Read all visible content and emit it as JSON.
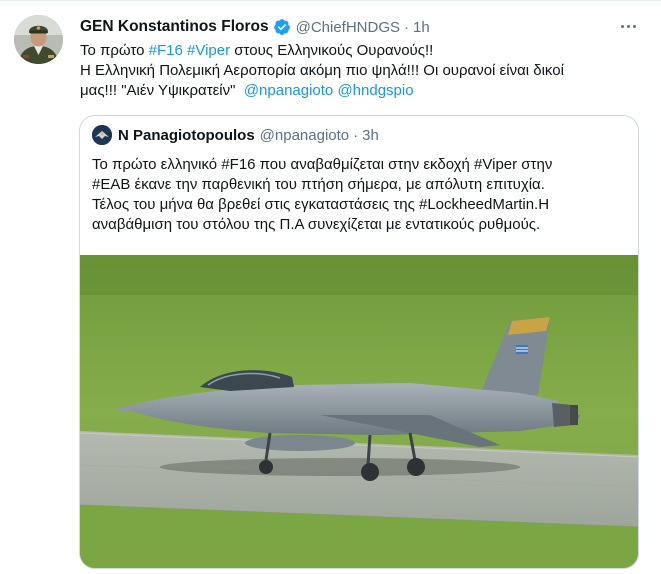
{
  "tweet": {
    "name": "GEN Konstantinos Floros",
    "handle": "@ChiefHNDGS",
    "separator": "·",
    "time": "1h",
    "line1": {
      "pre": "Το πρώτο ",
      "tag1": "#F16",
      "space": " ",
      "tag2": "#Viper",
      "post": " στους Ελληνικούς Ουρανούς!!"
    },
    "line2": "Η Ελληνική Πολεμική Αεροπορία ακόμη πιο ψηλά!!! Οι ουρανοί είναι δικοί",
    "line3": {
      "pre": "μας!!! \"Αιέν Υψικρατείν\"  ",
      "mention1": "@npanagioto",
      "space": " ",
      "mention2": "@hndgspio"
    }
  },
  "quote": {
    "name": "N Panagiotopoulos",
    "handle": "@npanagioto",
    "separator": "·",
    "time": "3h",
    "line1": "Το πρώτο ελληνικό #F16 που αναβαθμίζεται στην εκδοχή #Viper στην",
    "line2": "#ΕΑΒ έκανε την παρθενική του πτήση σήμερα, με απόλυτη επιτυχία.",
    "line3": "Τέλος του μήνα θα βρεθεί στις εγκαταστάσεις της #LockheedMartin.Η",
    "line4": "αναβάθμιση του στόλου της Π.Α συνεχίζεται με εντατικούς ρυθμούς."
  },
  "colors": {
    "link": "#1b95e0",
    "verified": "#1da1f2",
    "secondary_text": "#5b7083",
    "border": "#cfd9de"
  },
  "icons": {
    "verified": "verified-badge-icon",
    "more": "more-options-icon"
  }
}
